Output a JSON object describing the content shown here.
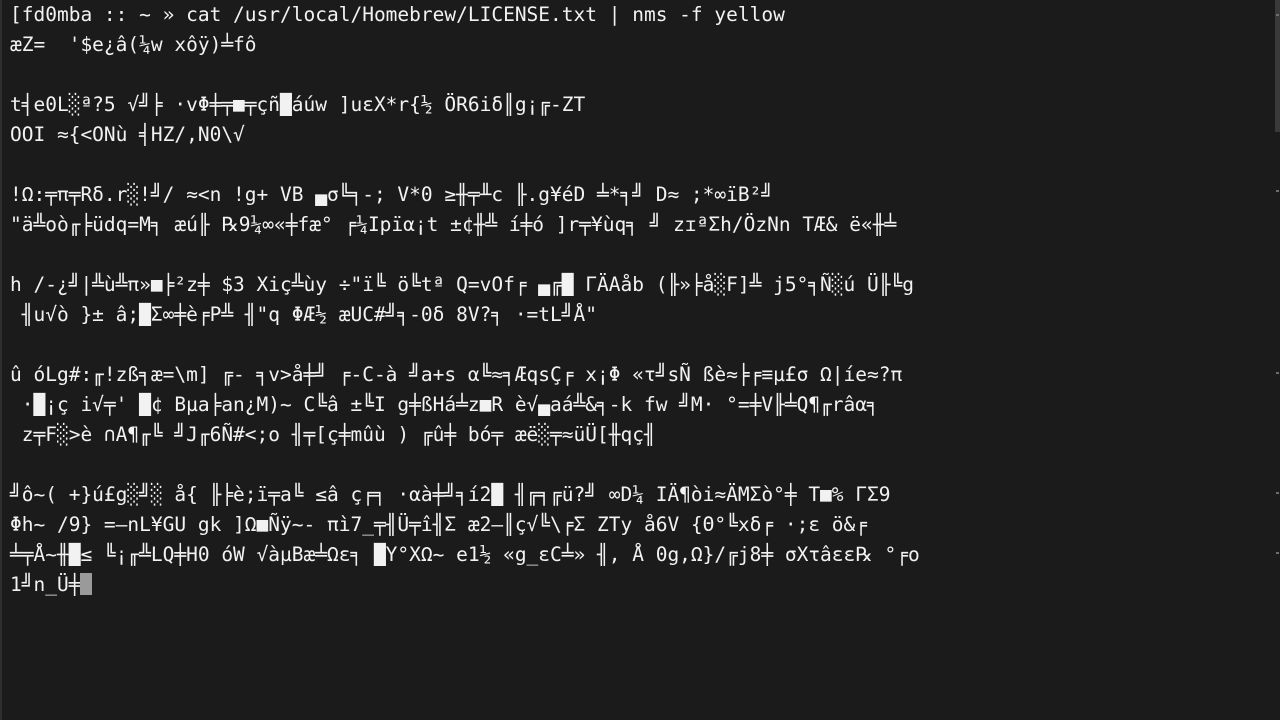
{
  "window": {
    "background_color": "#1b1b1b",
    "foreground_color": "#f2f2f2",
    "cursor_color": "#9a9a9a",
    "scrollbar_color": "#3a3a3a"
  },
  "prompt": {
    "full_line": "[fd0mba :: ~ » cat /usr/local/Homebrew/LICENSE.txt | nms -f yellow",
    "host": "fd0mba",
    "separator": "::",
    "path": "~",
    "chevron": "»",
    "command": "cat /usr/local/Homebrew/LICENSE.txt | nms -f yellow",
    "pipe_target": "nms",
    "flag": "-f",
    "flag_value": "yellow"
  },
  "output": {
    "lines": [
      "æZ=  '$e¿â(¼w xôÿ)╧fô",
      "",
      "t╡e0L░ª?5 √╝╞ ·vΦ╪╤■╤çñ█áúw ]uεX*r{½ ÖR6iδ║g¡╔-ZT",
      "OOI ≈{<ONù ╡HZ/,N0\\√",
      "",
      "!Ω:╤π╤Rδ.r░!╝/ ≈<n !g+ VB ▄σ╚╕-; V*0 ≥╫╤╨c ╟.g¥éD ╧*╕╝ D≈ ;*∞ïB²╝",
      "\"ä╩oò╓╞üdq=M╕ æú╟ ℞9¼∞«╪fæ° ╒¼Ipïα¡t ±¢╫╩ í╪ó ]r╤¥ùq╕ ╝ zɪªΣh/ÖzNn TÆ& ë«╫╧",
      "",
      "h /-¿╝|╩ù╩π»■╞²z╪ $3 Xiç╩ùy ÷\"ï╚ ö╚tª Q=vOf╒ ▄╔█ ΓÄAåb (╟»╞å░F]╩ j5°╕Ñ░ú Ü╟╚g",
      " ╢u√ò }± â;█Σ∞╪è╒P╩ ╢\"q ΦÆ½ æUC#╝╕-0δ 8V?╕ ·=tL╝Å\"",
      "",
      "û óLg#:╓!zß╕æ=\\m] ╔- ╕v>å╪╝ ╒-C-à ╝a+s α╚≈╕ÆqsÇ╒ x¡Φ «τ╝sÑ ßè≈╞╒≡µ£σ Ω|íe≈?π",
      " ·█¡ç i√╤' █¢ Bµa╞an¿M)~ C╚â ±╚I g╪ßHá╧z■R è√▄aá╩&╕-k fw ╝M· °=╪V╟╧Q¶╓râα╕",
      " z╤F░>è ∩A¶╓╚ ╝J╓6Ñ#<;o ╢╤[ç╪mûù ) ╔û╪ bó╤ æë░╤≈üÜ[╫qç╢",
      "",
      "╝ô~( +}ú£g░╝░ å{ ╟╞è;ï╤a╚ ≤â ç╒╕ ·αà╪╝╕í2█ ╢╔╕╔ü?╝ ∞D¼ IÄ¶òi≈ÄMΣò°╪ T■% ΓΣ9",
      "Φh~ /9} =—nL¥GU gk ]Ω■Ñÿ~- πì7_╤╢Ü╤î╢Σ æ2—║ç√╚\\╒Σ ZTy å6V {Θ°╚xδ╒ ·;ε ö&╒",
      "╧╤Å~╫█≤ ╚¡╓╩LQ╪H0 óW √àµBæ╧Ωε╕ █Y°XΩ~ e1½ «g_εC╧» ╢, Å 0g,Ω}/╔j8╪ σXτâεε℞ °╒o",
      "1╝n_Ü╪"
    ],
    "cursor_visible": true,
    "cursor_glyph": "block"
  }
}
